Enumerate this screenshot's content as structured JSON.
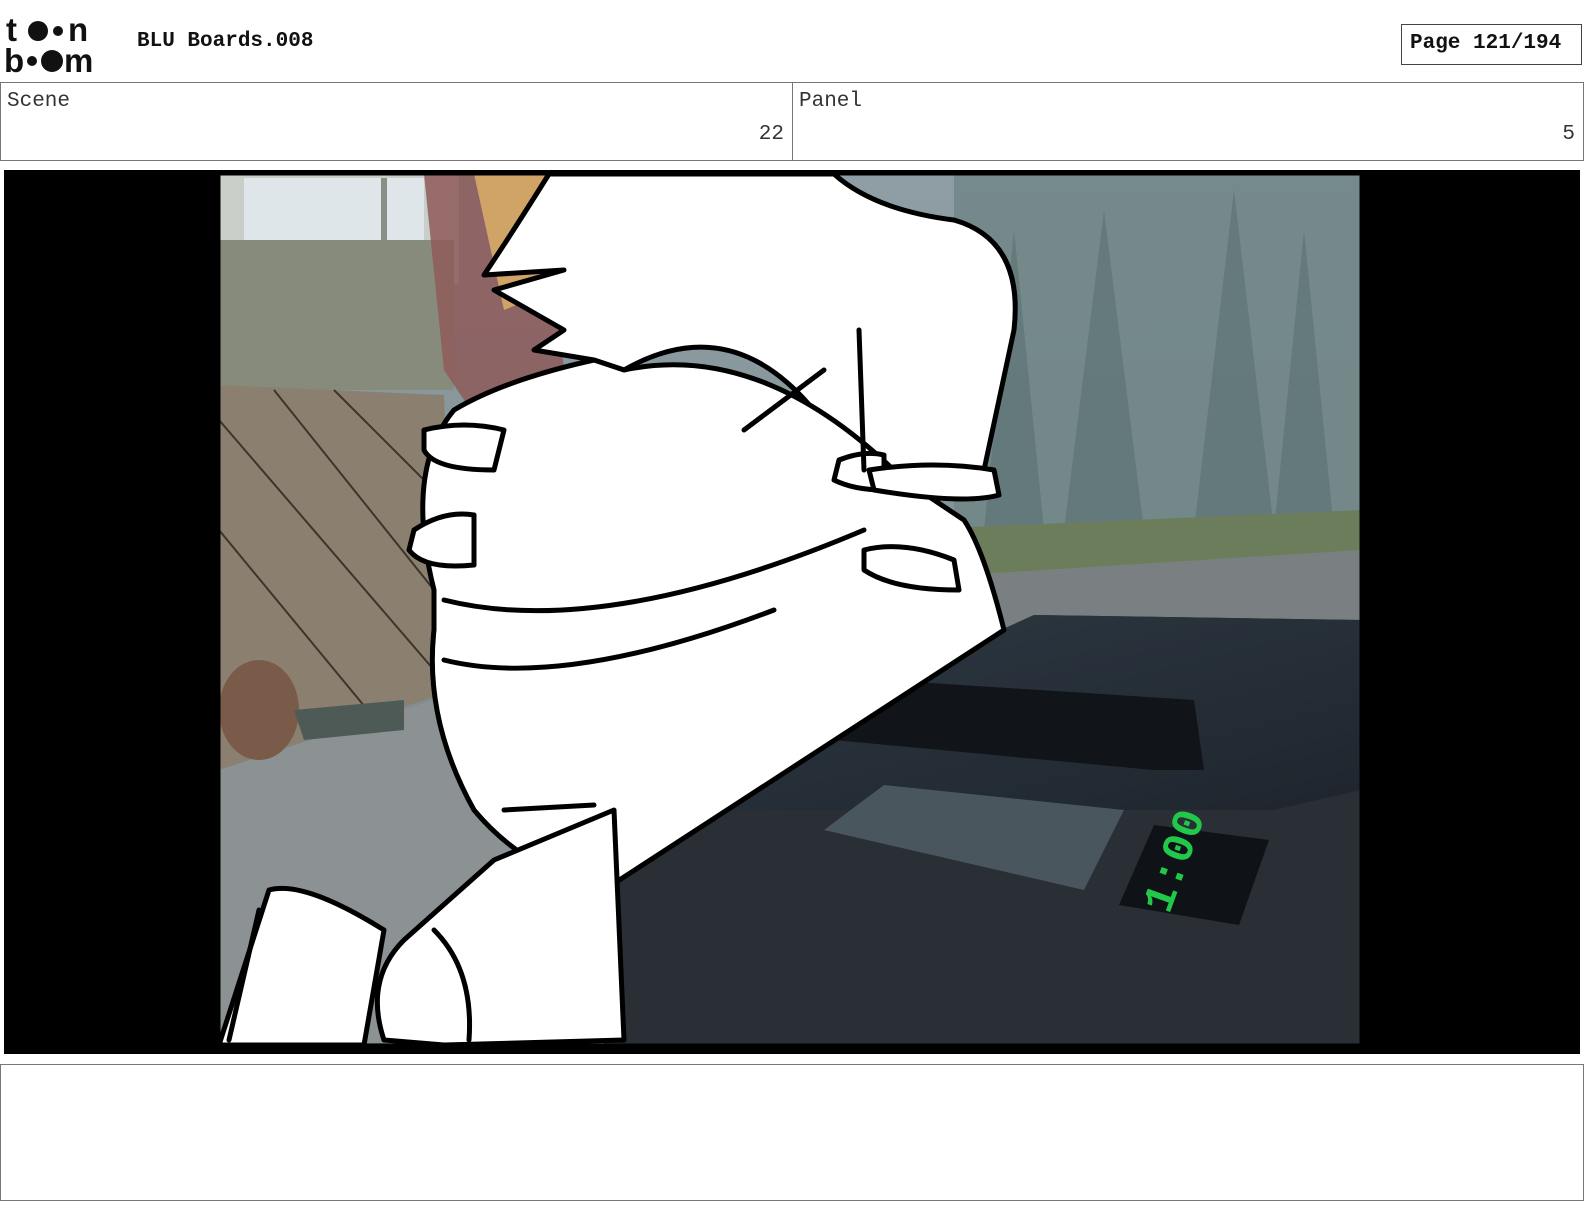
{
  "header": {
    "logo_text": "toon boom",
    "title": "BLU Boards.008",
    "page_indicator": "Page 121/194"
  },
  "info": {
    "scene_label": "Scene",
    "scene_value": "22",
    "panel_label": "Panel",
    "panel_value": "5"
  },
  "frame": {
    "timer_display": "1:00",
    "timer_color": "#22c84a",
    "letterbox_color": "#000000"
  },
  "notes": {
    "text": ""
  }
}
